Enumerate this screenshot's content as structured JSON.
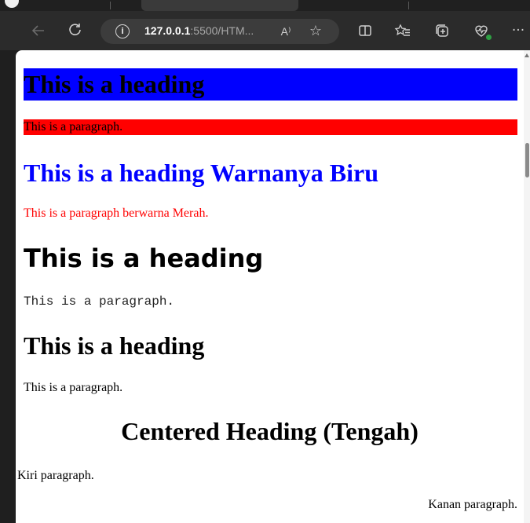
{
  "browser": {
    "address": {
      "host": "127.0.0.1",
      "rest": ":5500/HTM..."
    },
    "read_aloud_label": "A⁾",
    "buttons": [
      "back-icon",
      "refresh-icon",
      "info-icon",
      "read-aloud-icon",
      "favorite-star-icon",
      "split-screen-icon",
      "favorites-list-icon",
      "collections-icon",
      "health-icon",
      "more-icon"
    ]
  },
  "page": {
    "heading_blue_bg": "This is a heading",
    "paragraph_red_bg": "This is a paragraph.",
    "heading_blue_text": "This is a heading Warnanya Biru",
    "paragraph_red_text": "This is a paragraph berwarna Merah.",
    "heading_sans": "This is a heading",
    "paragraph_mono": "This is a paragraph.",
    "heading_plain": "This is a heading",
    "paragraph_plain": "This is a paragraph.",
    "heading_centered": "Centered Heading (Tengah)",
    "paragraph_left": "Kiri paragraph.",
    "paragraph_right": "Kanan paragraph."
  },
  "colors": {
    "blue": "#0000ff",
    "red": "#ff0000",
    "chrome_dark": "#2b2b2b"
  }
}
